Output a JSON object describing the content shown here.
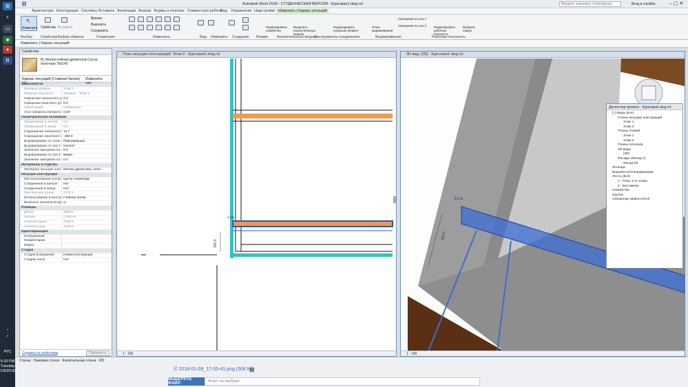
{
  "app": {
    "title": "Autodesk Revit 2018 - СТУДЕНЧЕСКАЯ ВЕРСИЯ -    Курсовая1.dwg.rvt",
    "search_placeholder": "Введите ключевое слово/фразу",
    "signin": "Вход в службы",
    "logo": "R"
  },
  "tabs": [
    "Архитектура",
    "Конструкция",
    "Системы",
    "Вставить",
    "Аннотации",
    "Анализ",
    "Формы и генплан",
    "Совместная работа",
    "Вид",
    "Управление",
    "Надстройки",
    "Изменить | Каркас несущий"
  ],
  "ribbon": {
    "groups": [
      "Выбор",
      "Свойства",
      "Буфер обмена",
      "Геометрия",
      "Изменить",
      "Вид",
      "Измерить",
      "Создание",
      "Режим",
      "Аналитическая модель",
      "Инструменты соединения",
      "Выравнивание",
      "Рабочая плоскость"
    ],
    "buttons": {
      "modify": "Изменить",
      "properties": "Свойства",
      "paste": "Вставить",
      "cut": "Врезка",
      "cut2": "Вырезать",
      "join": "Соединить",
      "edit_family": "Редактировать семейство",
      "highlight_analytical": "Выделить аналитическую модель",
      "edit_ref_element": "Редактировать опорный элемент",
      "align_points": "Точки выравнивания",
      "offset_y": "Смещения по оси Y",
      "offset_z": "Смещения по оси Z",
      "edit_workplane": "Редактировать рабочую плоскость",
      "pick_new": "Выбрать новую"
    }
  },
  "context_bar": "Изменить | Каркас несущий",
  "properties": {
    "title": "Свойства",
    "family": "M_Многослойная древесина-Сосна болотная\n78x140",
    "selector": "Каркас несущий (Главная балка) (1)",
    "edit_type": "Изменить тип",
    "rows": [
      {
        "k": "Зависимости",
        "v": "",
        "sec": true
      },
      {
        "k": "Базовый уровень",
        "v": "Этаж 2",
        "grey": true
      },
      {
        "k": "Рабочая плоскость",
        "v": "Уровень : Этаж 2",
        "grey": true
      },
      {
        "k": "Смещение начального ур...",
        "v": "0.0"
      },
      {
        "k": "Смещение конечного ур...",
        "v": "0.0"
      },
      {
        "k": "Ориентация",
        "v": "Нормально",
        "grey": true
      },
      {
        "k": "Угол поворота поперечн...",
        "v": "0.00°"
      },
      {
        "k": "Геометрическое положение",
        "v": "",
        "sec": true
      },
      {
        "k": "Примыкание в начале",
        "v": "0.0",
        "grey": true
      },
      {
        "k": "Примыкание в конце",
        "v": "0.0",
        "grey": true
      },
      {
        "k": "Сокращение начального ...",
        "v": "12.7"
      },
      {
        "k": "Сокращение конечного с...",
        "v": "-200.0"
      },
      {
        "k": "Выравнивание по осям YZ",
        "v": "Равномерный"
      },
      {
        "k": "Выравнивание по оси Y",
        "v": "Начало"
      },
      {
        "k": "Значение смещения по о...",
        "v": "0.0"
      },
      {
        "k": "Выравнивание по оси Z",
        "v": "Вверх"
      },
      {
        "k": "Значение смещения по о...",
        "v": "0.0"
      },
      {
        "k": "Материалы и отделка",
        "v": "",
        "sec": true
      },
      {
        "k": "Материал несущих конст...",
        "v": "Мягкая древесина, пило..."
      },
      {
        "k": "Несущие конструкции",
        "v": "",
        "sec": true
      },
      {
        "k": "Местоположение условн...",
        "v": "Центр геометрии"
      },
      {
        "k": "Соединение в начале",
        "v": "Нет"
      },
      {
        "k": "Соединение в конце",
        "v": "Нет"
      },
      {
        "k": "Фактическая длина",
        "v": "3722.3",
        "grey": true
      },
      {
        "k": "Использование в констр...",
        "v": "Главная балка"
      },
      {
        "k": "Включить аналитическую...",
        "v": "☑"
      },
      {
        "k": "Размеры",
        "v": "",
        "sec": true
      },
      {
        "k": "Длина",
        "v": "3860.0",
        "grey": true
      },
      {
        "k": "Объем",
        "v": "0.052 м³",
        "grey": true
      },
      {
        "k": "Отметка верха",
        "v": "4400.0",
        "grey": true
      },
      {
        "k": "Отметка низа",
        "v": "4260.0",
        "grey": true
      },
      {
        "k": "Идентификация",
        "v": "",
        "sec": true
      },
      {
        "k": "Изображение",
        "v": ""
      },
      {
        "k": "Комментарии",
        "v": ""
      },
      {
        "k": "Марка",
        "v": ""
      },
      {
        "k": "Стадии",
        "v": "",
        "sec": true
      },
      {
        "k": "Стадия возведения",
        "v": "Новая конструкция"
      },
      {
        "k": "Стадия сноса",
        "v": "Нет"
      }
    ],
    "help_link": "Справка по свойствам",
    "apply": "Применить"
  },
  "view1": {
    "title": "План несущих конструкций: Этаж 2 - Курсовая1.dwg.rvt",
    "scale": "1 : 100",
    "dim_label": "0 мм",
    "dim_label2": "300.0"
  },
  "view2": {
    "title": "3D вид: {3D} - Курсовая1.dwg.rvt",
    "scale": "1 : 100",
    "dim_a": "8.3 м",
    "dim_b": "360.0"
  },
  "browser": {
    "title": "Диспетчер проекта - Курсовая1.dwg.rvt",
    "items": [
      {
        "t": "[○] Виды (все)",
        "d": 0
      },
      {
        "t": "Планы несущих конструкций",
        "d": 1
      },
      {
        "t": "Этаж 1",
        "d": 2
      },
      {
        "t": "Этаж 2",
        "d": 2
      },
      {
        "t": "Планы этажей",
        "d": 1
      },
      {
        "t": "Этаж 1",
        "d": 2
      },
      {
        "t": "Этаж 2",
        "d": 2
      },
      {
        "t": "Планы потолков",
        "d": 1
      },
      {
        "t": "3D виды",
        "d": 1
      },
      {
        "t": "{3D}",
        "d": 2
      },
      {
        "t": "Фасады (Фасад 1)",
        "d": 1
      },
      {
        "t": "Фасад Юг",
        "d": 2
      },
      {
        "t": "Легенды",
        "d": 0
      },
      {
        "t": "Ведомости/Спецификации",
        "d": 0
      },
      {
        "t": "Листы (все)",
        "d": 0
      },
      {
        "t": "1 - План 1-го этажа",
        "d": 1
      },
      {
        "t": "2 - Без имени",
        "d": 1
      },
      {
        "t": "Семейства",
        "d": 0
      },
      {
        "t": "Группы",
        "d": 0
      },
      {
        "t": "Связанные файлы Revit",
        "d": 0
      }
    ]
  },
  "status_text": "Стены : Базовая стена : Капитальная стена : R5",
  "upload": {
    "file_name": "2018-01-09_17-05-41.png (508 Кб)",
    "choose": "ВЫБЕРИТЕ ФАЙЛ",
    "no_file": "Файл не выбран"
  },
  "taskbar": {
    "lang": "РУС",
    "time": "5:10 PM",
    "day": "Tuesday",
    "date": "1/9/2018"
  }
}
